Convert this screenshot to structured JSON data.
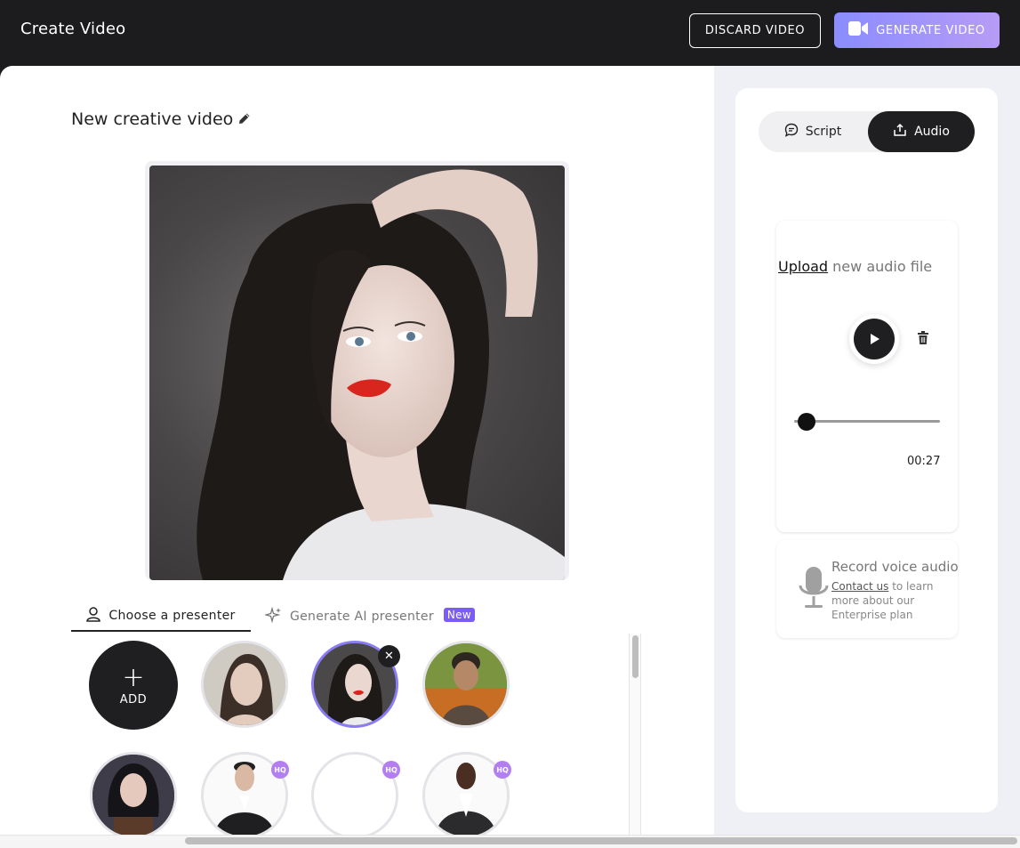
{
  "header": {
    "title": "Create Video",
    "discard_label": "DISCARD VIDEO",
    "generate_label": "GENERATE VIDEO"
  },
  "editor": {
    "video_title": "New creative video",
    "tabs": {
      "choose": "Choose a presenter",
      "generate": "Generate AI presenter",
      "generate_badge": "New"
    },
    "add_label": "ADD",
    "hq_badge": "HQ"
  },
  "panel": {
    "tabs": {
      "script": "Script",
      "audio": "Audio"
    },
    "upload_link": "Upload",
    "upload_rest": "new audio file",
    "time": "00:27",
    "progress": 0.05,
    "record_title": "Record voice audio",
    "record_link": "Contact us",
    "record_desc": "to learn more about our Enterprise plan"
  },
  "colors": {
    "accent": "#8a8cff",
    "selected_border": "#8a7cf6",
    "hq_badge": "#b37ef0",
    "new_badge": "#7b5cf6"
  }
}
